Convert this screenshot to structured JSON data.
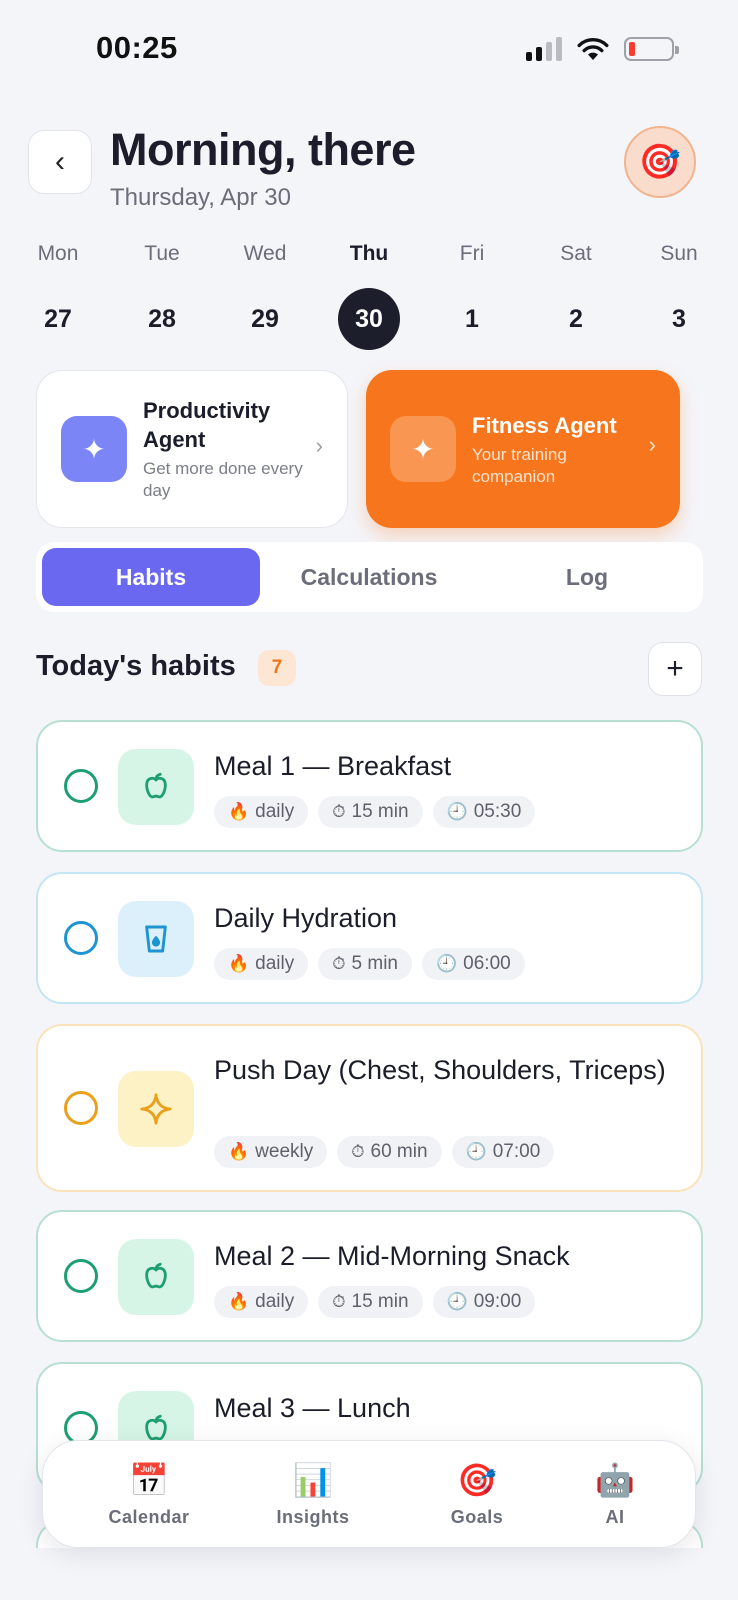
{
  "status": {
    "time": "00:25"
  },
  "header": {
    "back_icon": "chevron-left-icon",
    "greeting": "Morning, there",
    "date": "Thursday, Apr 30",
    "avatar_icon": "target-icon"
  },
  "week": [
    {
      "day": "Mon",
      "date": "27",
      "active": false
    },
    {
      "day": "Tue",
      "date": "28",
      "active": false
    },
    {
      "day": "Wed",
      "date": "29",
      "active": false
    },
    {
      "day": "Thu",
      "date": "30",
      "active": true
    },
    {
      "day": "Fri",
      "date": "1",
      "active": false
    },
    {
      "day": "Sat",
      "date": "2",
      "active": false
    },
    {
      "day": "Sun",
      "date": "3",
      "active": false
    }
  ],
  "agents": {
    "productivity": {
      "title": "Productivity Agent",
      "subtitle": "Get more done every day",
      "icon": "sparkle-icon",
      "color": "#7b85f6"
    },
    "fitness": {
      "title": "Fitness Agent",
      "subtitle": "Your training companion",
      "icon": "sparkle-icon",
      "color": "#f7751c"
    }
  },
  "tabs": [
    {
      "label": "Habits",
      "active": true
    },
    {
      "label": "Calculations",
      "active": false
    },
    {
      "label": "Log",
      "active": false
    }
  ],
  "section": {
    "title": "Today's habits",
    "count": "7",
    "add_label": "+"
  },
  "habits": [
    {
      "name": "Meal 1 — Breakfast",
      "icon": "apple-icon",
      "theme": "green",
      "frequency": "daily",
      "duration": "15 min",
      "time": "05:30"
    },
    {
      "name": "Daily Hydration",
      "icon": "water-glass-icon",
      "theme": "blue",
      "frequency": "daily",
      "duration": "5 min",
      "time": "06:00"
    },
    {
      "name": "Push Day (Chest, Shoulders, Triceps)",
      "icon": "sparkle-icon",
      "theme": "amber",
      "frequency": "weekly",
      "duration": "60 min",
      "time": "07:00"
    },
    {
      "name": "Meal 2 — Mid-Morning Snack",
      "icon": "apple-icon",
      "theme": "green",
      "frequency": "daily",
      "duration": "15 min",
      "time": "09:00"
    },
    {
      "name": "Meal 3 — Lunch",
      "icon": "apple-icon",
      "theme": "green",
      "frequency": "",
      "duration": "",
      "time": ""
    }
  ],
  "nav": [
    {
      "label": "Calendar",
      "icon": "calendar-icon"
    },
    {
      "label": "Insights",
      "icon": "bar-chart-icon"
    },
    {
      "label": "Goals",
      "icon": "target-icon"
    },
    {
      "label": "AI",
      "icon": "robot-icon"
    }
  ],
  "colors": {
    "accent": "#6a67f0",
    "orange": "#f7751c",
    "green": "#1e9e73",
    "blue": "#1e94d2",
    "amber": "#eba01c"
  }
}
